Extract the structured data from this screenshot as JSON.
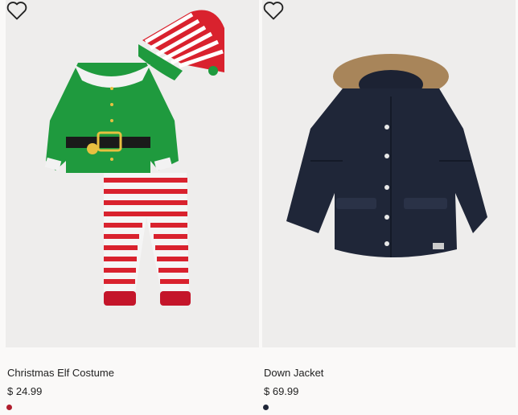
{
  "products": [
    {
      "title": "Christmas Elf Costume",
      "price": "$ 24.99",
      "swatch_color": "#b01e2e",
      "image_icon": "elf-costume-image"
    },
    {
      "title": "Down Jacket",
      "price": "$ 69.99",
      "swatch_color": "#1f2638",
      "image_icon": "down-jacket-image"
    }
  ]
}
